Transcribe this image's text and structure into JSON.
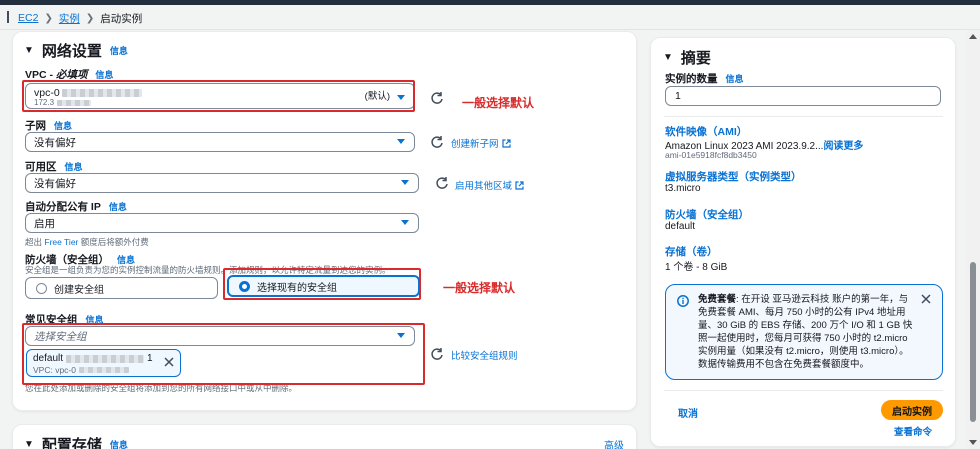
{
  "breadcrumb": {
    "root": "EC2",
    "mid": "实例",
    "current": "启动实例"
  },
  "network": {
    "title": "网络设置",
    "info": "信息",
    "vpc": {
      "label": "VPC - ",
      "label_req": "必填项",
      "value_prefix": "vpc-0",
      "value_suffix": "(默认)",
      "cidr": "172.3"
    },
    "subnet": {
      "label": "子网",
      "value": "没有偏好",
      "link": "创建新子网"
    },
    "az": {
      "label": "可用区",
      "value": "没有偏好",
      "link": "启用其他区域"
    },
    "public_ip": {
      "label": "自动分配公有 IP",
      "value": "启用",
      "note_prefix": "超出 ",
      "note_link": "Free Tier",
      "note_suffix": " 额度后将额外付费"
    },
    "firewall": {
      "label": "防火墙（安全组）",
      "desc": "安全组是一组负责为您的实例控制流量的防火墙规则。添加规则，以允许特定流量到达您的实例。",
      "option_create": "创建安全组",
      "option_existing": "选择现有的安全组"
    },
    "common_sg": {
      "label": "常见安全组",
      "placeholder": "选择安全组",
      "token_name": "default",
      "token_id_suffix": "1",
      "token_vpc": "VPC: vpc-0",
      "link": "比较安全组规则",
      "note": "您在此处添加或删除的安全组将添加到您的所有网络接口中或从中删除。"
    }
  },
  "annotations": {
    "vpc": "一般选择默认",
    "firewall": "一般选择默认"
  },
  "storage": {
    "title": "配置存储",
    "info": "信息",
    "advanced": "高级"
  },
  "summary": {
    "title": "摘要",
    "count_label": "实例的数量",
    "info": "信息",
    "count_value": "1",
    "ami_label": "软件映像（AMI）",
    "ami_value": "Amazon Linux 2023 AMI 2023.9.2...",
    "ami_more": "阅读更多",
    "ami_id": "ami-01e5918fcf8db3450",
    "type_label": "虚拟服务器类型（实例类型）",
    "type_value": "t3.micro",
    "fw_label": "防火墙（安全组）",
    "fw_value": "default",
    "storage_label": "存储（卷）",
    "storage_value": "1 个卷 - 8 GiB",
    "free_tier_bold": "免费套餐",
    "free_tier_text": ": 在开设 亚马逊云科技 账户的第一年，与免费套餐 AMI、每月 750 小时的公有 IPv4 地址用量、30 GiB 的 EBS 存储、200 万个 I/O 和 1 GB 快照一起使用时，您每月可获得 750 小时的 t2.micro 实例用量（如果没有 t2.micro，则使用 t3.micro）。数据传输费用不包含在免费套餐额度中。",
    "cancel": "取消",
    "launch": "启动实例",
    "preview": "查看命令"
  },
  "colors": {
    "accent": "#0972d3",
    "launch": "#ff9900",
    "annotation": "#d92b2b"
  }
}
